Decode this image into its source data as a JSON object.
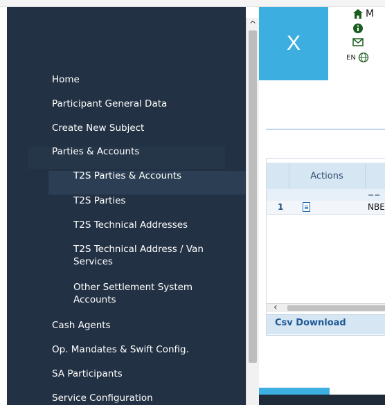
{
  "sidebar": {
    "items": [
      {
        "label": "Home"
      },
      {
        "label": "Participant General Data"
      },
      {
        "label": "Create New Subject"
      },
      {
        "label": "Parties & Accounts"
      },
      {
        "label": "T2S Parties & Accounts"
      },
      {
        "label": "T2S Parties"
      },
      {
        "label": "T2S Technical Addresses"
      },
      {
        "label": "T2S Technical Address / Van Services"
      },
      {
        "label": "Other Settlement System Accounts"
      },
      {
        "label": "Cash Agents"
      },
      {
        "label": "Op. Mandates & Swift Config."
      },
      {
        "label": "SA Participants"
      },
      {
        "label": "Service Configuration"
      }
    ]
  },
  "header": {
    "brand": "X",
    "lang": "EN",
    "initial": "M"
  },
  "grid": {
    "actions_header": "Actions",
    "filter_value": "==",
    "row_number": "1",
    "row_code": "NBE",
    "csv_download": "Csv Download"
  },
  "scrollbar": {
    "up_arrow": "^"
  },
  "colors": {
    "sidebar_bg": "#233144",
    "brand_bg": "#3daee0",
    "grid_header": "#d7e6f3"
  }
}
